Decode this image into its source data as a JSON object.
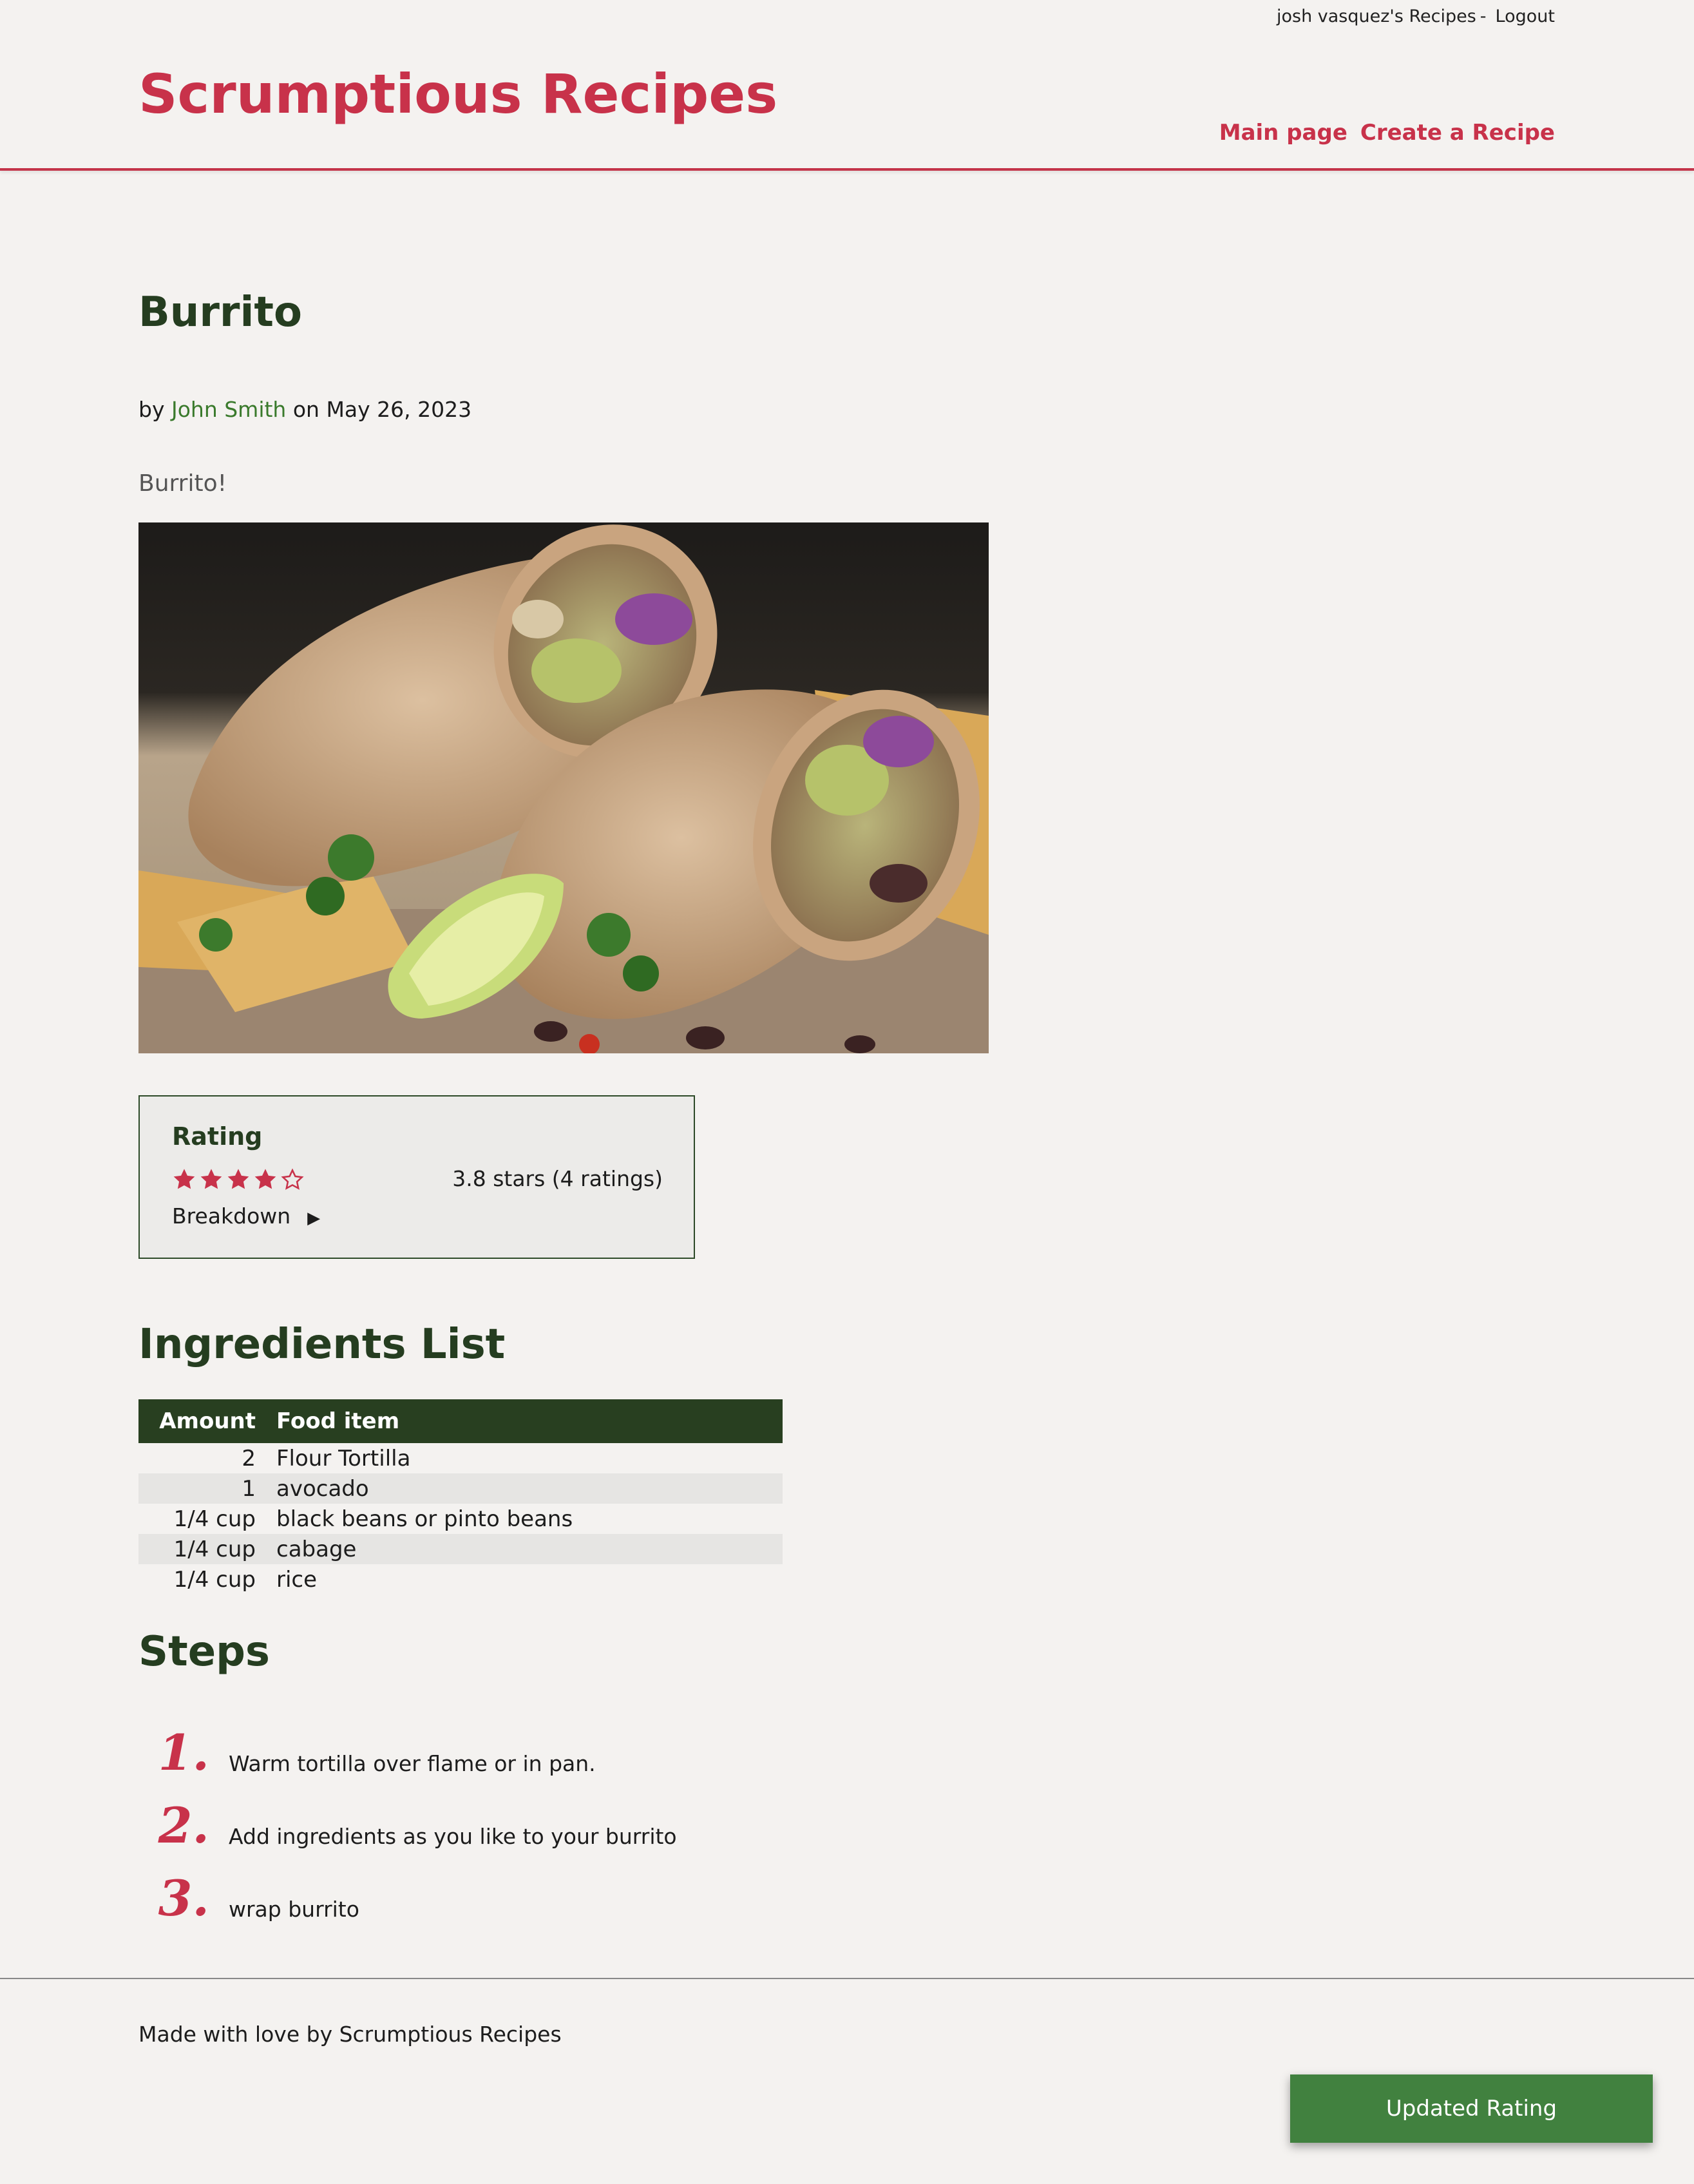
{
  "topbar": {
    "user_recipes": "josh vasquez's Recipes",
    "separator": "-",
    "logout": "Logout"
  },
  "header": {
    "site_title": "Scrumptious Recipes",
    "nav": {
      "main_page": "Main page",
      "create_recipe": "Create a Recipe"
    }
  },
  "recipe": {
    "title": "Burrito",
    "by": "by",
    "author": "John Smith",
    "on": "on",
    "date": "May 26, 2023",
    "description": "Burrito!"
  },
  "rating": {
    "heading": "Rating",
    "value": 3.8,
    "max": 5,
    "filled_stars": 4,
    "summary": "3.8 stars (4 ratings)",
    "breakdown_label": "Breakdown",
    "breakdown_toggle": "▶",
    "star_color": "#c8324a"
  },
  "ingredients": {
    "heading": "Ingredients List",
    "columns": {
      "amount": "Amount",
      "food": "Food item"
    },
    "rows": [
      {
        "amount": "2",
        "food": "Flour Tortilla"
      },
      {
        "amount": "1",
        "food": "avocado"
      },
      {
        "amount": "1/4 cup",
        "food": "black beans or pinto beans"
      },
      {
        "amount": "1/4 cup",
        "food": "cabage"
      },
      {
        "amount": "1/4 cup",
        "food": "rice"
      }
    ]
  },
  "steps": {
    "heading": "Steps",
    "items": [
      {
        "num": "1.",
        "text": "Warm tortilla over flame or in pan."
      },
      {
        "num": "2.",
        "text": "Add ingredients as you like to your burrito"
      },
      {
        "num": "3.",
        "text": "wrap burrito"
      }
    ]
  },
  "footer": {
    "text": "Made with love by Scrumptious Recipes"
  },
  "toast": {
    "text": "Updated Rating"
  },
  "colors": {
    "brand_red": "#c8324a",
    "dark_green": "#283f20",
    "link_green": "#3a7a2c",
    "toast_green": "#41813f"
  }
}
